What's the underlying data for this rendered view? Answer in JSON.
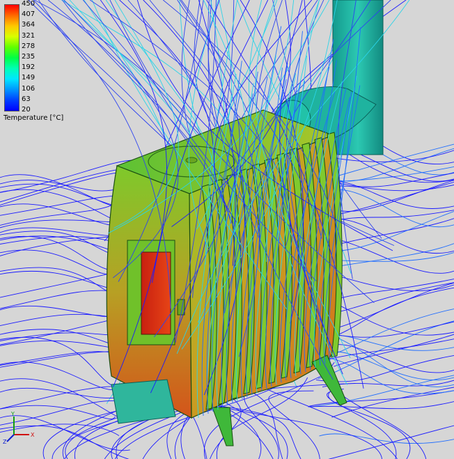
{
  "legend": {
    "title": "Temperature [°C]",
    "ticks": [
      "450",
      "407",
      "364",
      "321",
      "278",
      "235",
      "192",
      "149",
      "106",
      "63",
      "20"
    ],
    "colors": [
      "#ff0000",
      "#ff6a00",
      "#ffc800",
      "#d8ff00",
      "#60ff00",
      "#00ff44",
      "#00ffb4",
      "#00e6ff",
      "#0096ff",
      "#0040ff",
      "#0000ff"
    ]
  },
  "scene": {
    "background": "#d6d6d6",
    "streamline_colors": [
      "#1a1aff",
      "#2d43f0",
      "#1e6cff",
      "#2bd3e8"
    ],
    "stove_colors": {
      "hot": "#e23a12",
      "warm": "#c9a022",
      "mid": "#8fcf2a",
      "cool": "#3fc23a",
      "pipe": "#1fb7a7"
    }
  },
  "triad": {
    "x": "X",
    "y": "Y",
    "z": "Z"
  }
}
